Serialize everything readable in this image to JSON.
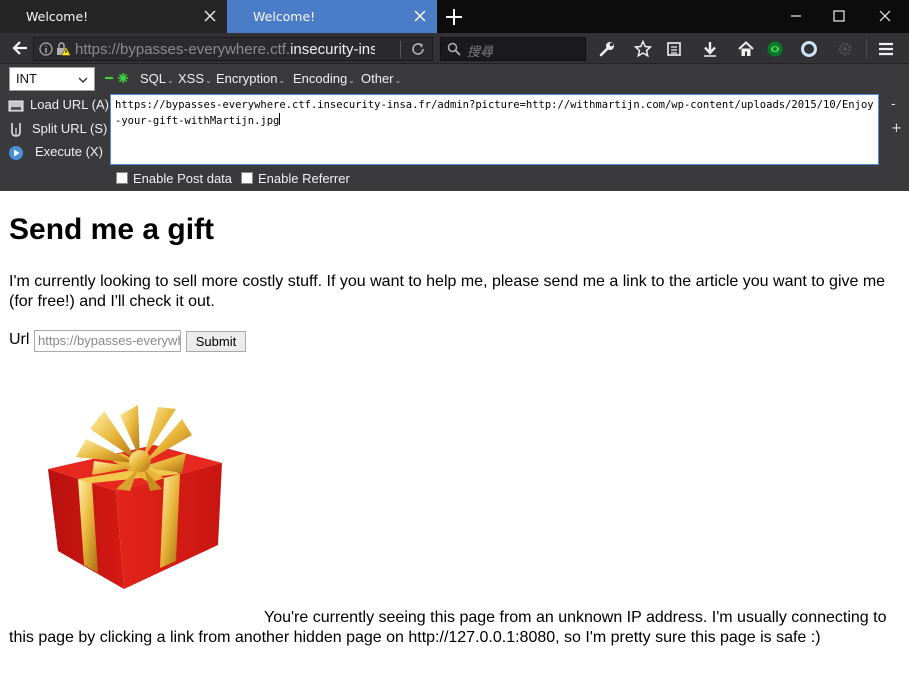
{
  "browser": {
    "tabs": [
      {
        "label": "Welcome!",
        "active": false
      },
      {
        "label": "Welcome!",
        "active": true
      }
    ],
    "url_prefix": "https://bypasses-everywhere.ctf.",
    "url_host": "insecurity-insa",
    "search_placeholder": "搜尋",
    "colors": {
      "active_tab": "#4a7cc8",
      "chrome": "#323234",
      "hackbar": "#3a3a3d"
    }
  },
  "hackbar": {
    "select_value": "INT",
    "menus": [
      "SQL",
      "XSS",
      "Encryption",
      "Encoding",
      "Other"
    ],
    "load_url_label": "Load URL (A)",
    "split_url_label": "Split URL (S)",
    "execute_label": "Execute (X)",
    "textarea_value": "https://bypasses-everywhere.ctf.insecurity-insa.fr/admin?picture=http://withmartijn.com/wp-content/uploads/2015/10/Enjoy-your-gift-withMartijn.jpg",
    "minus_label": "-",
    "plus_label": "+",
    "enable_post_label": "Enable Post data",
    "enable_referrer_label": "Enable Referrer"
  },
  "page": {
    "title": "Send me a gift",
    "intro": "I'm currently looking to sell more costly stuff. If you want to help me, please send me a link to the article you want to give me (for free!) and I'll check it out.",
    "url_label": "Url",
    "url_placeholder": "https://bypasses-everywhere",
    "submit_label": "Submit",
    "footer": "You're currently seeing this page from an unknown IP address. I'm usually connecting to this page by clicking a link from another hidden page on http://127.0.0.1:8080, so I'm pretty sure this page is safe :)"
  }
}
